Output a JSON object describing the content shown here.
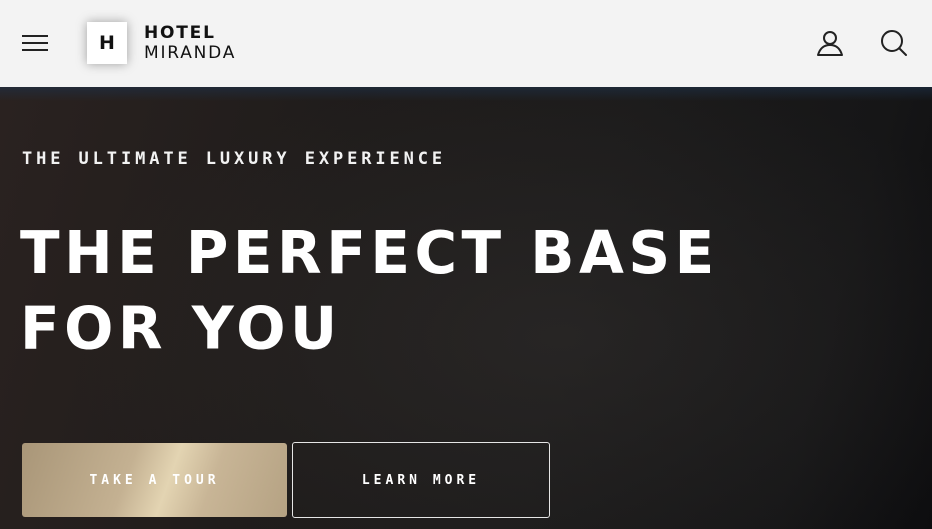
{
  "header": {
    "logo_mark": "H",
    "logo_line1": "HOTEL",
    "logo_line2": "MIRANDA",
    "menu_icon": "hamburger-menu-icon",
    "account_icon": "user-icon",
    "search_icon": "search-icon"
  },
  "hero": {
    "eyebrow": "THE ULTIMATE LUXURY EXPERIENCE",
    "headline": "THE PERFECT BASE FOR YOU",
    "primary_button": "TAKE A TOUR",
    "secondary_button": "LEARN MORE"
  },
  "colors": {
    "navbar_background": "#f3f3f3",
    "hero_background": "#1c1b1b",
    "accent_gold": "#c8b596",
    "text_light": "#ffffff"
  }
}
